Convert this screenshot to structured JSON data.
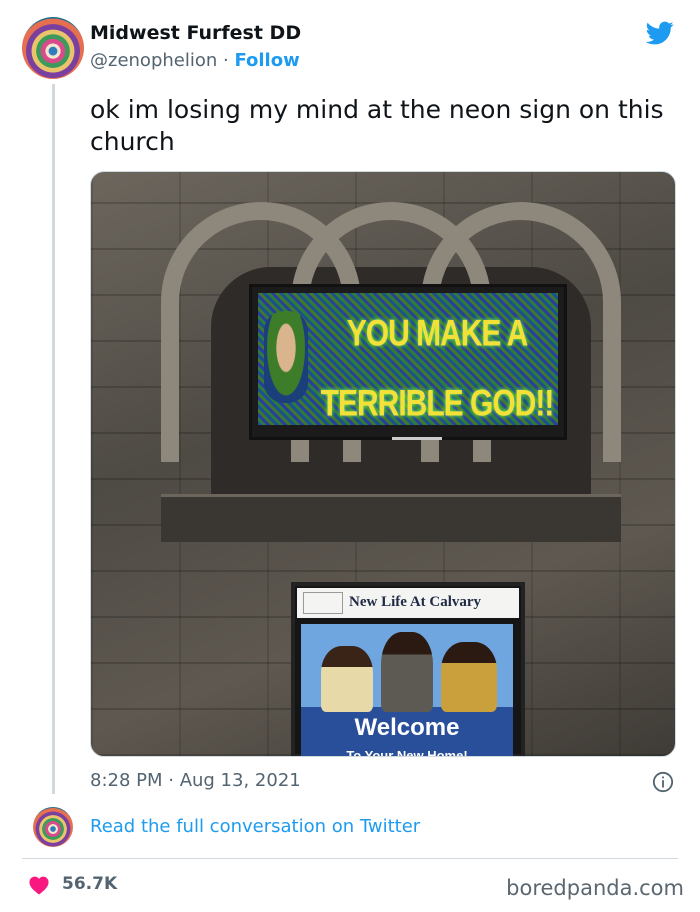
{
  "author": {
    "name": "Midwest Furfest DD",
    "handle": "@zenophelion",
    "separator": " · ",
    "follow_label": "Follow"
  },
  "tweet": {
    "text": "ok im losing my mind at the neon sign on this church",
    "timestamp": "8:28 PM · Aug 13, 2021",
    "likes": "56.7K"
  },
  "photo": {
    "sign_text": "YOU MAKE A TERRIBLE GOD!!",
    "board_title": "New Life At Calvary",
    "board_welcome": "Welcome",
    "board_sub": "To Your New Home!"
  },
  "footer": {
    "read_link": "Read the full conversation on Twitter",
    "watermark": "boredpanda.com"
  },
  "colors": {
    "link": "#1d9bf0",
    "heart": "#f91880",
    "muted": "#536471"
  },
  "icons": [
    "twitter-bird-icon",
    "info-icon",
    "heart-icon"
  ]
}
